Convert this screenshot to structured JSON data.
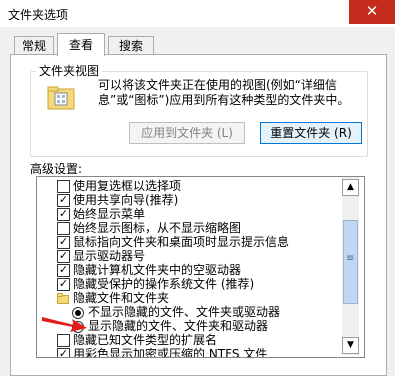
{
  "window": {
    "title": "文件夹选项",
    "close_glyph": "✕"
  },
  "tabs": [
    {
      "label": "常规"
    },
    {
      "label": "查看"
    },
    {
      "label": "搜索"
    }
  ],
  "folder_views": {
    "title": "文件夹视图",
    "description": "可以将该文件夹正在使用的视图(例如“详细信息”或“图标”)应用到所有这种类型的文件夹中。",
    "apply_button": "应用到文件夹 (L)",
    "reset_button": "重置文件夹 (R)"
  },
  "advanced": {
    "label": "高级设置:",
    "items": [
      {
        "label": "使用复选框以选择项",
        "checked": false
      },
      {
        "label": "使用共享向导(推荐)",
        "checked": true
      },
      {
        "label": "始终显示菜单",
        "checked": true
      },
      {
        "label": "始终显示图标，从不显示缩略图",
        "checked": false
      },
      {
        "label": "鼠标指向文件夹和桌面项时显示提示信息",
        "checked": true
      },
      {
        "label": "显示驱动器号",
        "checked": true
      },
      {
        "label": "隐藏计算机文件夹中的空驱动器",
        "checked": true
      },
      {
        "label": "隐藏受保护的操作系统文件 (推荐)",
        "checked": true
      },
      {
        "label": "隐藏文件和文件夹",
        "folder": true
      },
      {
        "label": "不显示隐藏的文件、文件夹或驱动器",
        "radio": true,
        "selected": true
      },
      {
        "label": "显示隐藏的文件、文件夹和驱动器",
        "radio": true,
        "selected": false
      },
      {
        "label": "隐藏已知文件类型的扩展名",
        "checked": false
      },
      {
        "label": "用彩色显示加密或压缩的 NTFS 文件",
        "checked": true
      }
    ]
  },
  "scrollbar": {
    "up_glyph": "▲",
    "down_glyph": "▼",
    "grip_glyph": "≡"
  },
  "colors": {
    "close": "#c42b1c",
    "accent": "#0078d7",
    "arrow": "#e31b1b"
  }
}
